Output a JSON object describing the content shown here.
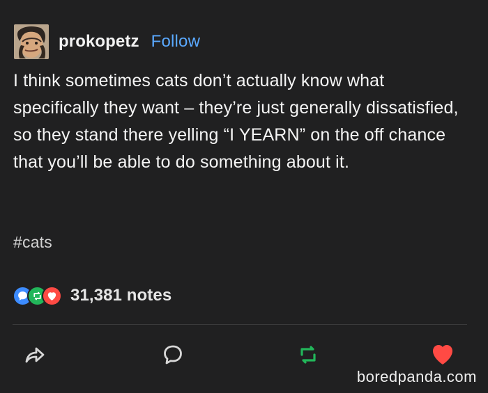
{
  "post": {
    "username": "prokopetz",
    "follow_label": "Follow",
    "body": "I think sometimes cats don’t actually know what specifically they want – they’re just generally dissatisfied, so they stand there yelling “I YEARN” on the off chance that you’ll be able to do something about it.",
    "tag": "#cats",
    "notes_count": "31,381 notes"
  },
  "watermark": "boredpanda.com",
  "colors": {
    "background": "#202021",
    "follow": "#5aa9ff",
    "reply": "#3d8cff",
    "reblog": "#22b65a",
    "like": "#ff4a44"
  },
  "icons": {
    "avatar": "avatar-portrait-icon",
    "note_reply": "reply-icon",
    "note_reblog": "reblog-icon",
    "note_like": "heart-icon",
    "share": "share-icon",
    "reply": "reply-icon",
    "reblog": "reblog-icon",
    "like": "heart-icon"
  }
}
